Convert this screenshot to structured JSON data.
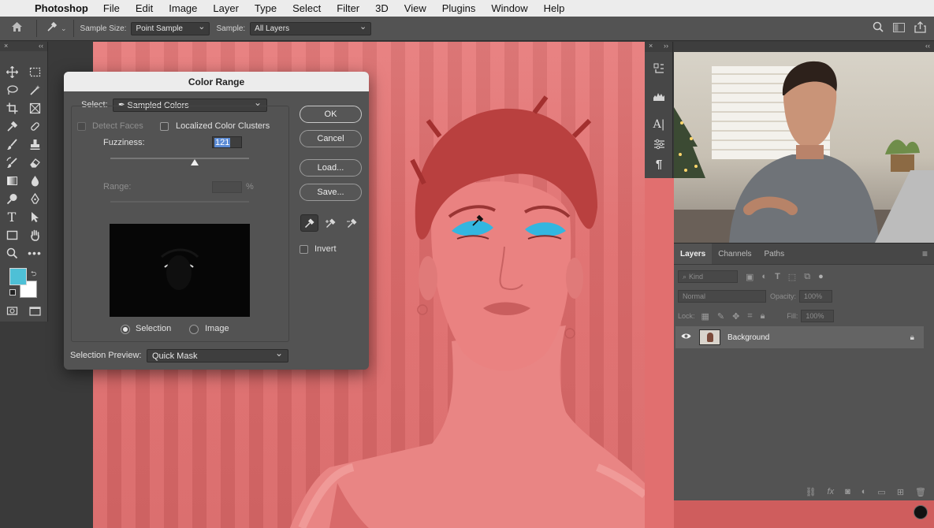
{
  "menubar": {
    "app_name": "Photoshop",
    "items": [
      "File",
      "Edit",
      "Image",
      "Layer",
      "Type",
      "Select",
      "Filter",
      "3D",
      "View",
      "Plugins",
      "Window",
      "Help"
    ]
  },
  "options_bar": {
    "sample_size_label": "Sample Size:",
    "sample_size_value": "Point Sample",
    "sample_label": "Sample:",
    "sample_value": "All Layers"
  },
  "color_range": {
    "title": "Color Range",
    "select_label": "Select:",
    "select_value": "Sampled Colors",
    "detect_faces_label": "Detect Faces",
    "localized_label": "Localized Color Clusters",
    "fuzziness_label": "Fuzziness:",
    "fuzziness_value": "121",
    "fuzziness_level": 0.61,
    "range_label": "Range:",
    "range_unit": "%",
    "ok_label": "OK",
    "cancel_label": "Cancel",
    "load_label": "Load...",
    "save_label": "Save...",
    "invert_label": "Invert",
    "selection_radio_label": "Selection",
    "image_radio_label": "Image",
    "preview_label": "Selection Preview:",
    "preview_value": "Quick Mask"
  },
  "layers_panel": {
    "tabs": [
      "Layers",
      "Channels",
      "Paths"
    ],
    "kind_placeholder": "Kind",
    "blend_mode": "Normal",
    "opacity_label": "Opacity:",
    "opacity_value": "100%",
    "lock_label": "Lock:",
    "fill_label": "Fill:",
    "fill_value": "100%",
    "layer_name": "Background"
  },
  "colors": {
    "foreground": "#4ec0d6",
    "background": "#ffffff",
    "quick_mask": "#e06e6e",
    "selection_highlight": "#33b6e0"
  }
}
